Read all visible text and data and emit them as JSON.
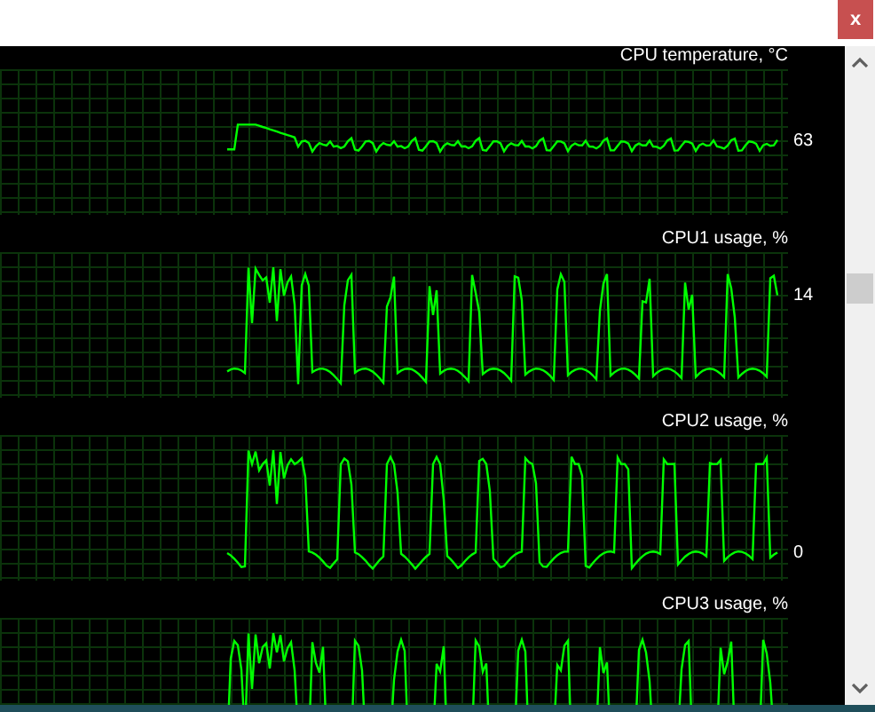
{
  "close_button": {
    "label": "x"
  },
  "panels": [
    {
      "title": "CPU temperature, °C",
      "reading": "63",
      "kind": "temperature"
    },
    {
      "title": "CPU1 usage, %",
      "reading": "14",
      "kind": "usage"
    },
    {
      "title": "CPU2 usage, %",
      "reading": "0",
      "kind": "usage"
    },
    {
      "title": "CPU3 usage, %",
      "kind": "usage"
    }
  ]
}
